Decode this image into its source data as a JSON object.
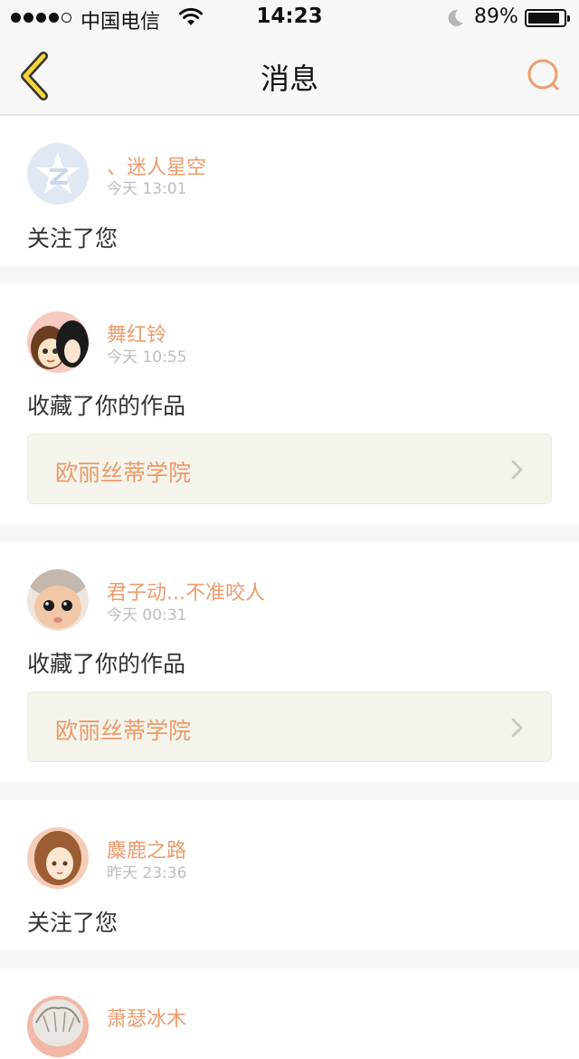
{
  "status_bar": {
    "carrier": "中国电信",
    "time": "14:23",
    "battery_percent": "89%",
    "battery_level": 0.89,
    "signal_bars": 4,
    "signal_total": 5
  },
  "nav": {
    "title": "消息",
    "back_icon": "chevron-left-icon",
    "search_icon": "search-icon"
  },
  "colors": {
    "accent": "#ec9b6d",
    "back_arrow": "#f5d33a",
    "work_card_bg": "#f5f4ec"
  },
  "messages": [
    {
      "name": "、迷人星空",
      "time": "今天 13:01",
      "action": "关注了您"
    },
    {
      "name": "舞红铃",
      "time": "今天 10:55",
      "action": "收藏了你的作品",
      "work": "欧丽丝蒂学院"
    },
    {
      "name": "君子动...不准咬人",
      "time": "今天 00:31",
      "action": "收藏了你的作品",
      "work": "欧丽丝蒂学院"
    },
    {
      "name": "麋鹿之路",
      "time": "昨天 23:36",
      "action": "关注了您"
    },
    {
      "name": "萧瑟冰木"
    }
  ]
}
